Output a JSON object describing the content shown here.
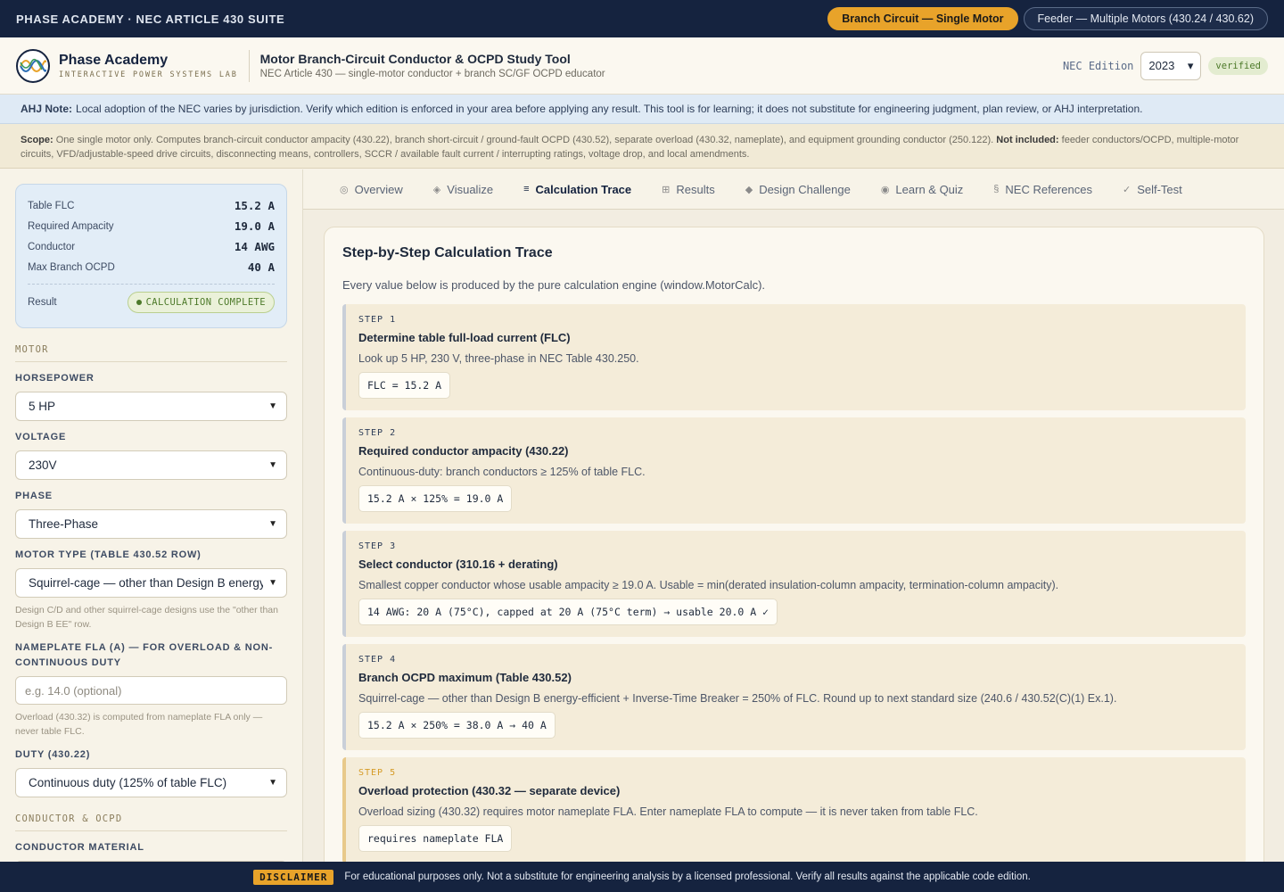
{
  "topbar": {
    "brand": "PHASE ACADEMY · NEC ARTICLE 430 SUITE",
    "tabs": [
      {
        "label": "Branch Circuit — Single Motor"
      },
      {
        "label": "Feeder — Multiple Motors (430.24 / 430.62)"
      }
    ]
  },
  "header": {
    "brand_name": "Phase Academy",
    "brand_sub": "INTERACTIVE POWER SYSTEMS LAB",
    "app_title": "Motor Branch-Circuit Conductor & OCPD Study Tool",
    "app_subtitle": "NEC Article 430 — single-motor conductor + branch SC/GF OCPD educator",
    "edition_label": "NEC Edition",
    "edition_value": "2023",
    "edition_badge": "verified"
  },
  "ahj": {
    "label": "AHJ Note:",
    "text": "Local adoption of the NEC varies by jurisdiction. Verify which edition is enforced in your area before applying any result. This tool is for learning; it does not substitute for engineering judgment, plan review, or AHJ interpretation."
  },
  "scope": {
    "label": "Scope:",
    "text": "One single motor only. Computes branch-circuit conductor ampacity (430.22), branch short-circuit / ground-fault OCPD (430.52), separate overload (430.32, nameplate), and equipment grounding conductor (250.122).",
    "not_included_label": "Not included:",
    "not_included_text": "feeder conductors/OCPD, multiple-motor circuits, VFD/adjustable-speed drive circuits, disconnecting means, controllers, SCCR / available fault current / interrupting ratings, voltage drop, and local amendments."
  },
  "summary": {
    "rows": [
      {
        "label": "Table FLC",
        "value": "15.2 A"
      },
      {
        "label": "Required Ampacity",
        "value": "19.0 A"
      },
      {
        "label": "Conductor",
        "value": "14 AWG"
      },
      {
        "label": "Max Branch OCPD",
        "value": "40 A"
      }
    ],
    "result_label": "Result",
    "result_value": "CALCULATION COMPLETE"
  },
  "form": {
    "motor_section": "MOTOR",
    "horsepower_label": "HORSEPOWER",
    "horsepower_value": "5 HP",
    "voltage_label": "VOLTAGE",
    "voltage_value": "230V",
    "phase_label": "PHASE",
    "phase_value": "Three-Phase",
    "motor_type_label": "MOTOR TYPE (TABLE 430.52 ROW)",
    "motor_type_value": "Squirrel-cage — other than Design B energy-efficient",
    "motor_type_hint": "Design C/D and other squirrel-cage designs use the \"other than Design B EE\" row.",
    "fla_label": "NAMEPLATE FLA (A) — FOR OVERLOAD & NON-CONTINUOUS DUTY",
    "fla_placeholder": "e.g. 14.0 (optional)",
    "fla_hint": "Overload (430.32) is computed from nameplate FLA only — never table FLC.",
    "duty_label": "DUTY (430.22)",
    "duty_value": "Continuous duty (125% of table FLC)",
    "conductor_section": "CONDUCTOR & OCPD",
    "material_label": "CONDUCTOR MATERIAL"
  },
  "tabs": [
    {
      "icon": "◎",
      "label": "Overview"
    },
    {
      "icon": "◈",
      "label": "Visualize"
    },
    {
      "icon": "≡",
      "label": "Calculation Trace"
    },
    {
      "icon": "⊞",
      "label": "Results"
    },
    {
      "icon": "◆",
      "label": "Design Challenge"
    },
    {
      "icon": "◉",
      "label": "Learn & Quiz"
    },
    {
      "icon": "§",
      "label": "NEC References"
    },
    {
      "icon": "✓",
      "label": "Self-Test"
    }
  ],
  "trace": {
    "title": "Step-by-Step Calculation Trace",
    "intro": "Every value below is produced by the pure calculation engine (window.MotorCalc).",
    "steps": [
      {
        "num": "STEP 1",
        "title": "Determine table full-load current (FLC)",
        "desc": "Look up 5 HP, 230 V, three-phase in NEC Table 430.250.",
        "code": "FLC = 15.2 A"
      },
      {
        "num": "STEP 2",
        "title": "Required conductor ampacity (430.22)",
        "desc": "Continuous-duty: branch conductors ≥ 125% of table FLC.",
        "code": "15.2 A × 125% = 19.0 A"
      },
      {
        "num": "STEP 3",
        "title": "Select conductor (310.16 + derating)",
        "desc": "Smallest copper conductor whose usable ampacity ≥ 19.0 A. Usable = min(derated insulation-column ampacity, termination-column ampacity).",
        "code": "14 AWG: 20 A (75°C), capped at 20 A (75°C term) → usable 20.0 A ✓"
      },
      {
        "num": "STEP 4",
        "title": "Branch OCPD maximum (Table 430.52)",
        "desc": "Squirrel-cage — other than Design B energy-efficient + Inverse-Time Breaker = 250% of FLC. Round up to next standard size (240.6 / 430.52(C)(1) Ex.1).",
        "code": "15.2 A × 250% = 38.0 A → 40 A"
      },
      {
        "num": "STEP 5",
        "title": "Overload protection (430.32 — separate device)",
        "desc": "Overload sizing (430.32) requires motor nameplate FLA. Enter nameplate FLA to compute — it is never taken from table FLC.",
        "code": "requires nameplate FLA"
      }
    ]
  },
  "footer": {
    "tag": "DISCLAIMER",
    "text": "For educational purposes only. Not a substitute for engineering analysis by a licensed professional. Verify all results against the applicable code edition."
  },
  "colors": {
    "accent": "#e8a32a",
    "navy": "#15233f",
    "success": "#4d7a2a"
  }
}
